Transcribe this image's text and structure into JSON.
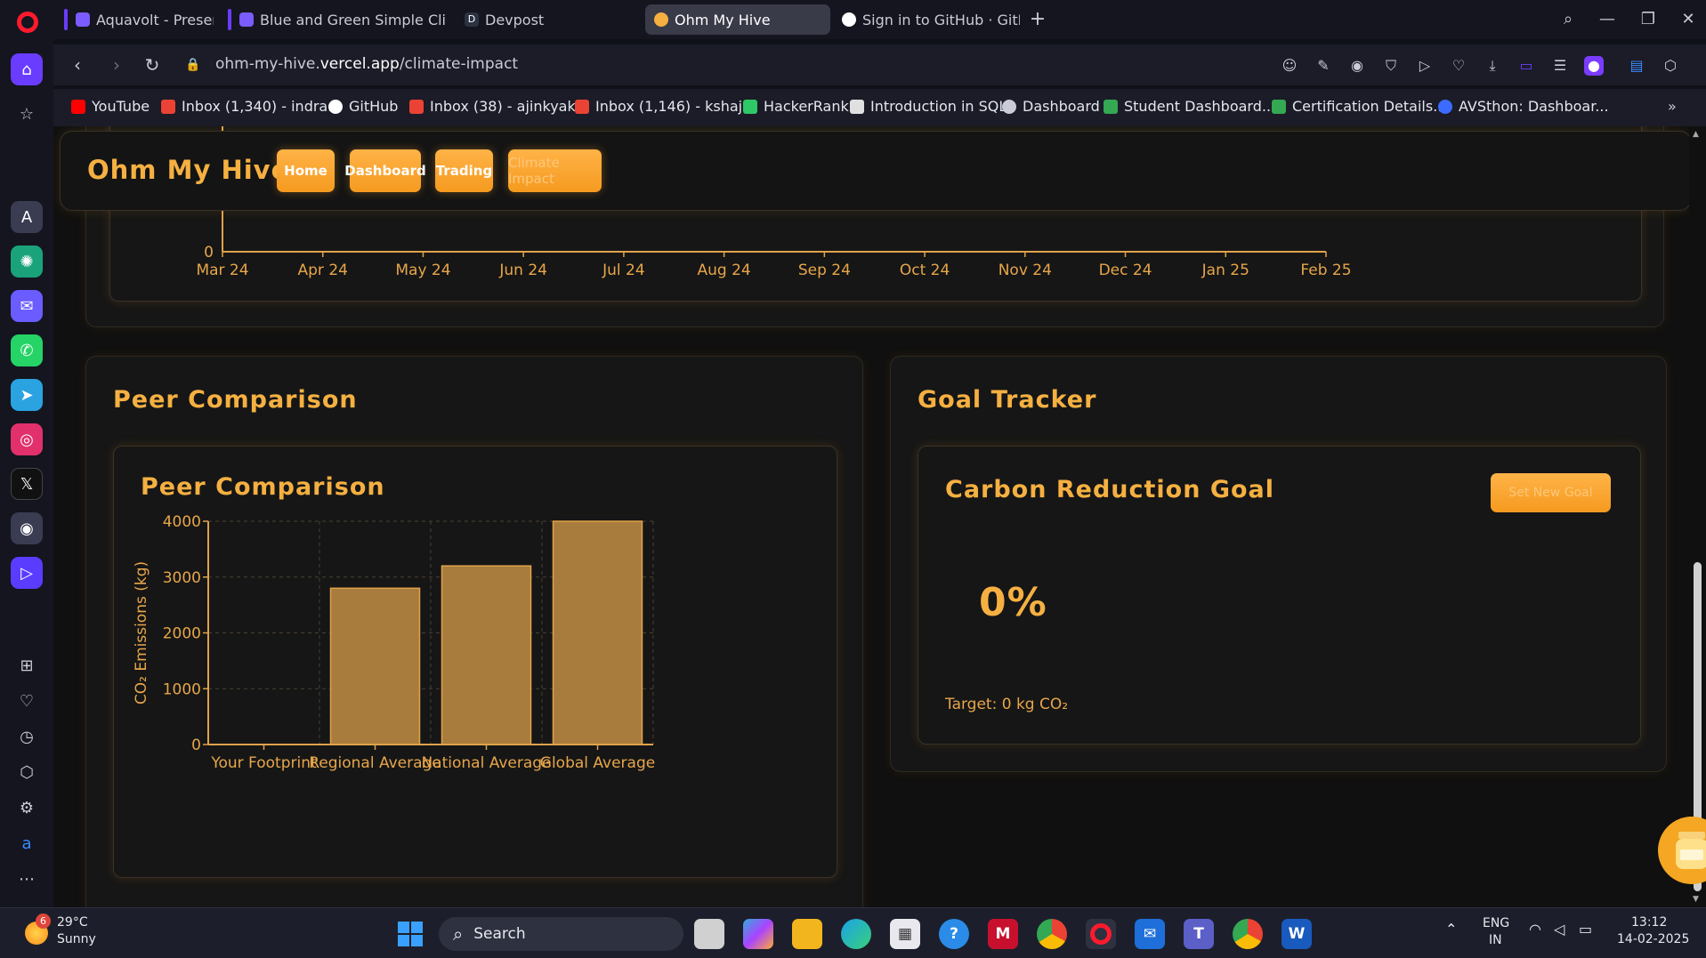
{
  "browser": {
    "tabs": [
      {
        "label": "Aquavolt - Presentation -",
        "color": "#7a5cff",
        "active": false
      },
      {
        "label": "Blue and Green Simple Cli",
        "color": "#7a5cff",
        "active": false
      },
      {
        "label": "Devpost",
        "color": "#2b3242",
        "active": false
      },
      {
        "label": "Ohm My Hive",
        "color": "#f5b041",
        "active": true
      },
      {
        "label": "Sign in to GitHub · GitHub",
        "color": "#ffffff",
        "active": false
      }
    ],
    "url_prefix": "ohm-my-hive.",
    "url_domain": "vercel.app",
    "url_path": "/climate-impact",
    "bookmarks": [
      {
        "label": "YouTube",
        "color": "#ff0000"
      },
      {
        "label": "Inbox (1,340) - indra...",
        "color": "#ea4335"
      },
      {
        "label": "GitHub",
        "color": "#ffffff"
      },
      {
        "label": "Inbox (38) - ajinkyak...",
        "color": "#ea4335"
      },
      {
        "label": "Inbox (1,146) - kshaj...",
        "color": "#ea4335"
      },
      {
        "label": "HackerRank",
        "color": "#2ec866"
      },
      {
        "label": "Introduction in SQL",
        "color": "#e0e0e0"
      },
      {
        "label": "Dashboard",
        "color": "#c9cbd6"
      },
      {
        "label": "Student Dashboard...",
        "color": "#35a853"
      },
      {
        "label": "Certification Details...",
        "color": "#35a853"
      },
      {
        "label": "AVSthon: Dashboar...",
        "color": "#3b6cff"
      }
    ]
  },
  "app": {
    "brand": "Ohm My Hive",
    "nav": [
      "Home",
      "Dashboard",
      "Trading",
      "Climate Impact"
    ]
  },
  "timeline": {
    "zero_label": "0",
    "months": [
      "Mar 24",
      "Apr 24",
      "May 24",
      "Jun 24",
      "Jul 24",
      "Aug 24",
      "Sep 24",
      "Oct 24",
      "Nov 24",
      "Dec 24",
      "Jan 25",
      "Feb 25"
    ]
  },
  "peer": {
    "section_title": "Peer Comparison",
    "chart_title": "Peer Comparison"
  },
  "goal": {
    "section_title": "Goal Tracker",
    "card_title": "Carbon Reduction Goal",
    "button_label": "Set New Goal",
    "percent": "0%",
    "target": "Target: 0 kg CO₂"
  },
  "chart_data": {
    "type": "bar",
    "title": "Peer Comparison",
    "xlabel": "",
    "ylabel": "CO₂ Emissions (kg)",
    "categories": [
      "Your Footprint",
      "Regional Average",
      "National Average",
      "Global Average"
    ],
    "values": [
      0,
      2800,
      3200,
      4000
    ],
    "ylim": [
      0,
      4000
    ],
    "yticks": [
      0,
      1000,
      2000,
      3000,
      4000
    ],
    "grid": true,
    "bar_color": "#a87c3c",
    "bar_border": "#e0a24a"
  },
  "taskbar": {
    "temp": "29°C",
    "condition": "Sunny",
    "weather_badge": "6",
    "search_label": "Search",
    "lang1": "ENG",
    "lang2": "IN",
    "time": "13:12",
    "date": "14-02-2025"
  }
}
